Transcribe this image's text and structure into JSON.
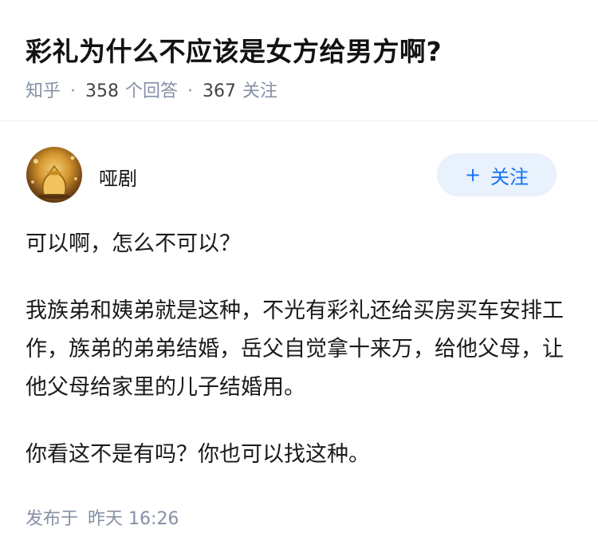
{
  "question": {
    "title": "彩礼为什么不应该是女方给男方啊?",
    "source": "知乎",
    "answer_count": "358",
    "answer_label": "个回答",
    "follower_count": "367",
    "follower_label": "关注"
  },
  "answer": {
    "author_name": "哑剧",
    "follow_button_label": "关注",
    "follow_button_icon": "plus-icon",
    "paragraphs": [
      "可以啊，怎么不可以？",
      "我族弟和姨弟就是这种，不光有彩礼还给买房买车安排工作，族弟的弟弟结婚，岳父自觉拿十来万，给他父母，让他父母给家里的儿子结婚用。",
      "你看这不是有吗？你也可以找这种。"
    ],
    "publish_label": "发布于",
    "publish_day": "昨天",
    "publish_time": "16:26"
  },
  "colors": {
    "accent": "#1772f6",
    "button_bg": "#e8f1fc",
    "meta_text": "#8590a6"
  }
}
